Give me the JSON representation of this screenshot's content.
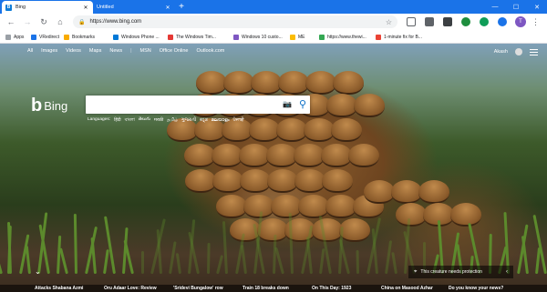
{
  "browser": {
    "tabs": [
      {
        "label": "Bing",
        "favicon": "B"
      },
      {
        "label": "Untitled"
      }
    ],
    "url": "https://www.bing.com",
    "profile_initial": "T"
  },
  "bookmarks": [
    {
      "label": "Apps",
      "color": "#9aa0a6"
    },
    {
      "label": "VRedirect",
      "color": "#1a73e8"
    },
    {
      "label": "Bookmarks",
      "color": "#f9ab00"
    },
    {
      "label": "Windows Phone ...",
      "color": "#0078d7"
    },
    {
      "label": "The Windows Tim...",
      "color": "#e53935"
    },
    {
      "label": "Windows 10 custo...",
      "color": "#7e57c2"
    },
    {
      "label": "ME",
      "color": "#fbbc04"
    },
    {
      "label": "https://www.thewi...",
      "color": "#34a853"
    },
    {
      "label": "1-minute fix for B...",
      "color": "#ea4335"
    }
  ],
  "bing": {
    "nav": [
      "All",
      "Images",
      "Videos",
      "Maps",
      "News",
      "|",
      "MSN",
      "Office Online",
      "Outlook.com"
    ],
    "user_name": "Akash",
    "logo_text": "Bing",
    "languages_label": "Languages:",
    "languages": [
      "हिंदी",
      "বাংলা",
      "తెలుగు",
      "मराठी",
      "தமிழ்",
      "ગુજરાતી",
      "ಕನ್ನಡ",
      "മലയാളം",
      "ਪੰਜਾਬੀ"
    ],
    "image_info": "This creature needs protection",
    "headlines": [
      "Attacks Shabana Azmi",
      "Oru Adaar Love: Review",
      "'Sridevi Bungalow' row",
      "Train 18 breaks down",
      "On This Day: 1923",
      "China on Masood Azhar",
      "Do you know your news?"
    ]
  }
}
